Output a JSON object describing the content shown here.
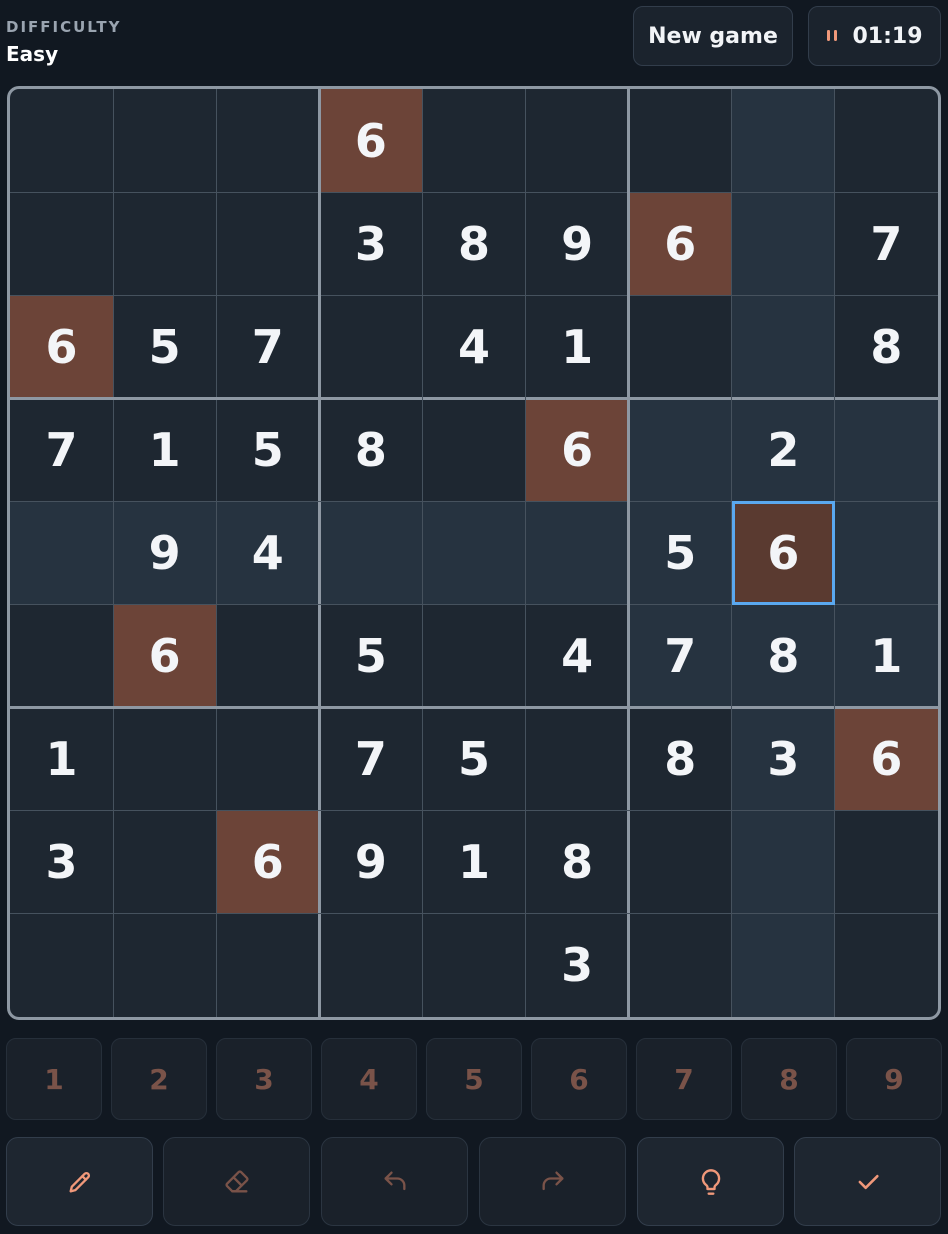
{
  "header": {
    "difficulty_label": "DIFFICULTY",
    "difficulty_value": "Easy",
    "new_game_label": "New game",
    "timer": "01:19",
    "timer_icon": "pause-icon"
  },
  "board": {
    "selected": {
      "row": 4,
      "col": 7
    },
    "highlight_digit": "6",
    "rows": [
      [
        "",
        "",
        "",
        "6",
        "",
        "",
        "",
        "",
        ""
      ],
      [
        "",
        "",
        "",
        "3",
        "8",
        "9",
        "6",
        "",
        "7"
      ],
      [
        "6",
        "5",
        "7",
        "",
        "4",
        "1",
        "",
        "",
        "8"
      ],
      [
        "7",
        "1",
        "5",
        "8",
        "",
        "6",
        "",
        "2",
        ""
      ],
      [
        "",
        "9",
        "4",
        "",
        "",
        "",
        "5",
        "6",
        ""
      ],
      [
        "",
        "6",
        "",
        "5",
        "",
        "4",
        "7",
        "8",
        "1"
      ],
      [
        "1",
        "",
        "",
        "7",
        "5",
        "",
        "8",
        "3",
        "6"
      ],
      [
        "3",
        "",
        "6",
        "9",
        "1",
        "8",
        "",
        "",
        ""
      ],
      [
        "",
        "",
        "",
        "",
        "",
        "3",
        "",
        "",
        ""
      ]
    ]
  },
  "numpad": [
    "1",
    "2",
    "3",
    "4",
    "5",
    "6",
    "7",
    "8",
    "9"
  ],
  "tools": [
    {
      "name": "pencil",
      "icon": "pencil-icon"
    },
    {
      "name": "erase",
      "icon": "eraser-icon"
    },
    {
      "name": "undo",
      "icon": "undo-icon"
    },
    {
      "name": "redo",
      "icon": "redo-icon"
    },
    {
      "name": "hint",
      "icon": "lightbulb-icon"
    },
    {
      "name": "check",
      "icon": "check-icon"
    }
  ],
  "colors": {
    "accent": "#f0987a",
    "muted_accent": "#7a5349",
    "same_digit_bg": "#6c4438",
    "selected_border": "#5aa8ef",
    "peer_bg": "#263340",
    "cell_bg": "#1e2731",
    "page_bg": "#111821"
  }
}
